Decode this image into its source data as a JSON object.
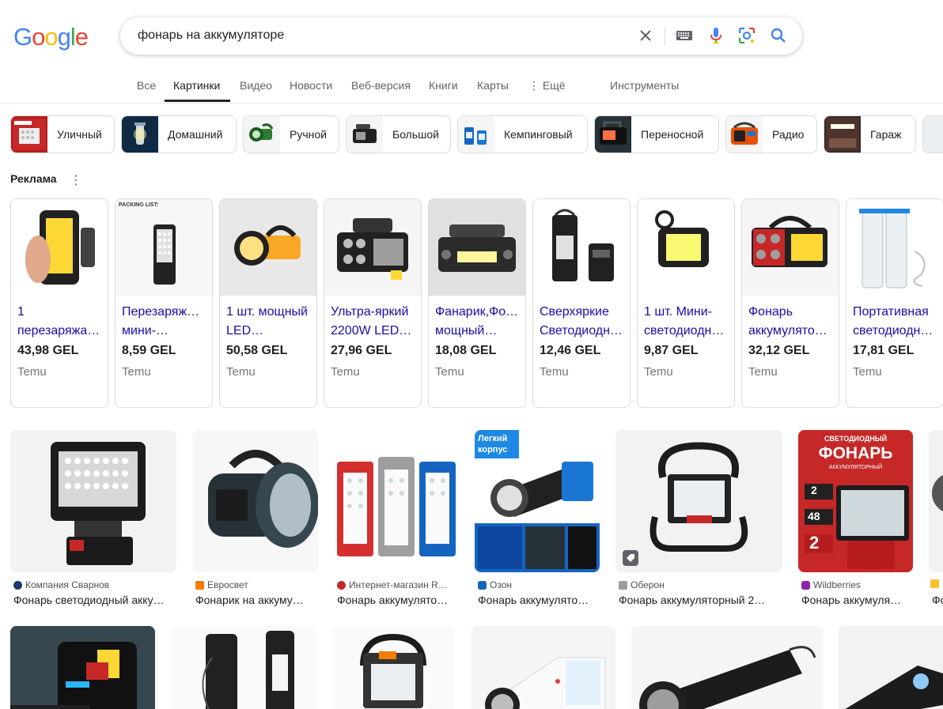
{
  "logo": {
    "letters": [
      "G",
      "o",
      "o",
      "g",
      "l",
      "e"
    ],
    "colors": [
      "#4285f4",
      "#ea4335",
      "#fbbc05",
      "#4285f4",
      "#34a853",
      "#ea4335"
    ]
  },
  "search": {
    "query": "фонарь на аккумуляторе"
  },
  "tabs": [
    {
      "label": "Все"
    },
    {
      "label": "Картинки"
    },
    {
      "label": "Видео"
    },
    {
      "label": "Новости"
    },
    {
      "label": "Веб-версия"
    },
    {
      "label": "Книги"
    },
    {
      "label": "Карты"
    },
    {
      "label": "⋮ Ещё"
    },
    {
      "label": "Инструменты"
    }
  ],
  "chips": [
    {
      "label": "Уличный"
    },
    {
      "label": "Домашний"
    },
    {
      "label": "Ручной"
    },
    {
      "label": "Большой"
    },
    {
      "label": "Кемпинговый"
    },
    {
      "label": "Переносной"
    },
    {
      "label": "Радио"
    },
    {
      "label": "Гараж"
    }
  ],
  "ads": {
    "title": "Реклама",
    "items": [
      {
        "title": "1 перезаряжа…",
        "price": "43,98 GEL",
        "store": "Temu"
      },
      {
        "title": "Перезаряжаем мини-…",
        "price": "8,59 GEL",
        "store": "Temu"
      },
      {
        "title": "1 шт. мощный LED…",
        "price": "50,58 GEL",
        "store": "Temu"
      },
      {
        "title": "Ультра-яркий 2200W LED…",
        "price": "27,96 GEL",
        "store": "Temu"
      },
      {
        "title": "Фанарик,Фонар мощный…",
        "price": "18,08 GEL",
        "store": "Temu"
      },
      {
        "title": "Сверхяркие Светодиодн…",
        "price": "12,46 GEL",
        "store": "Temu"
      },
      {
        "title": "1 шт. Мини-светодиодн…",
        "price": "9,87 GEL",
        "store": "Temu"
      },
      {
        "title": "Фонарь аккумулятор…",
        "price": "32,12 GEL",
        "store": "Temu"
      },
      {
        "title": "Портативная светодиодн…",
        "price": "17,81 GEL",
        "store": "Temu"
      }
    ]
  },
  "results": [
    {
      "source": "Компания Сварнов",
      "title": "Фонарь светодиодный акку…",
      "fav": "#1a3a6b"
    },
    {
      "source": "Евросвет",
      "title": "Фонарик на аккуму…",
      "fav": "#f57c00"
    },
    {
      "source": "Интернет-магазин R…",
      "title": "Фонарь аккумулято…",
      "fav": "#c62828"
    },
    {
      "source": "Озон",
      "title": "Фонарь аккумулято…",
      "fav": "#1565c0"
    },
    {
      "source": "Оберон",
      "title": "Фонарь аккумуляторный 2…",
      "fav": "#9e9e9e"
    },
    {
      "source": "Wildberries",
      "title": "Фонарь аккумуля…",
      "fav": "#8e24aa"
    },
    {
      "source": "",
      "title": "Фо",
      "fav": "#fbc02d"
    }
  ],
  "overlay_texts": {
    "ozon_badge": "Легкий корпус",
    "wb_top": "СВЕТОДИОДНЫЙ",
    "wb_big": "ФОНАРЬ",
    "wb_sub": "АККУМУЛЯТОРНЫЙ",
    "wb_num1": "2",
    "wb_num2": "48",
    "wb_num3": "2",
    "packing": "PACKING LIST:"
  }
}
